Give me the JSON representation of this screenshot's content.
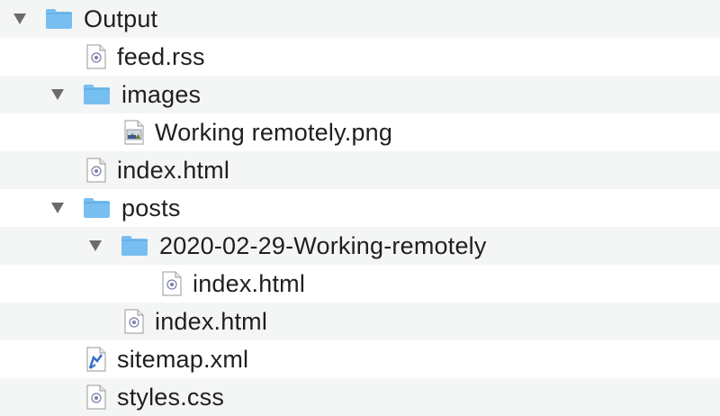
{
  "tree": {
    "rows": [
      {
        "label": "Output",
        "type": "folder",
        "expanded": true,
        "depth": 0,
        "icon": "folder-icon"
      },
      {
        "label": "feed.rss",
        "type": "file",
        "depth": 1,
        "icon": "html-document-icon"
      },
      {
        "label": "images",
        "type": "folder",
        "expanded": true,
        "depth": 1,
        "icon": "folder-icon"
      },
      {
        "label": "Working remotely.png",
        "type": "file",
        "depth": 2,
        "icon": "image-document-icon"
      },
      {
        "label": "index.html",
        "type": "file",
        "depth": 1,
        "icon": "html-document-icon"
      },
      {
        "label": "posts",
        "type": "folder",
        "expanded": true,
        "depth": 1,
        "icon": "folder-icon"
      },
      {
        "label": "2020-02-29-Working-remotely",
        "type": "folder",
        "expanded": true,
        "depth": 2,
        "icon": "folder-icon"
      },
      {
        "label": "index.html",
        "type": "file",
        "depth": 3,
        "icon": "html-document-icon"
      },
      {
        "label": "index.html",
        "type": "file",
        "depth": 2,
        "icon": "html-document-icon"
      },
      {
        "label": "sitemap.xml",
        "type": "file",
        "depth": 1,
        "icon": "xml-document-icon"
      },
      {
        "label": "styles.css",
        "type": "file",
        "depth": 1,
        "icon": "html-document-icon"
      }
    ]
  },
  "colors": {
    "folder": "#78bff1",
    "folder_tab": "#5aa9e4",
    "alt_row": "#f4f5f5",
    "disclosure": "#6b6b6b"
  }
}
